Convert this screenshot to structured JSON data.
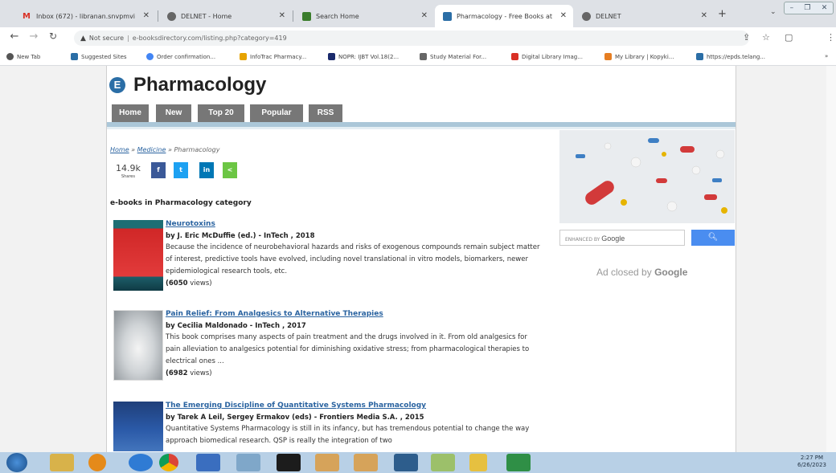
{
  "browser": {
    "tabs": [
      {
        "label": "Inbox (672) - libranan.snvpmvi",
        "icon_color": "#d93025"
      },
      {
        "label": "DELNET - Home",
        "icon_color": "#555555"
      },
      {
        "label": "Search Home",
        "icon_color": "#3a7d2c"
      },
      {
        "label": "Pharmacology - Free Books at",
        "icon_color": "#2b6ea6",
        "active": true
      },
      {
        "label": "DELNET",
        "icon_color": "#555555"
      }
    ],
    "new_tab": "+",
    "address": {
      "security": "Not secure",
      "url": "e-booksdirectory.com/listing.php?category=419"
    },
    "bookmarks": [
      {
        "label": "New Tab",
        "color": "#555555"
      },
      {
        "label": "Suggested Sites",
        "color": "#2b6ea6"
      },
      {
        "label": "Order confirmation...",
        "color": "#4285f4"
      },
      {
        "label": "InfoTrac Pharmacy...",
        "color": "#e6a300"
      },
      {
        "label": "NOPR: IJBT Vol.18(2...",
        "color": "#1a2a6c"
      },
      {
        "label": "Study Material For...",
        "color": "#666666"
      },
      {
        "label": "Digital Library Imag...",
        "color": "#d93025"
      },
      {
        "label": "My Library | Kopyki...",
        "color": "#e67e22"
      },
      {
        "label": "https://epds.telang...",
        "color": "#2b6ea6"
      }
    ],
    "bookmarks_more": "»"
  },
  "site": {
    "logo": "E",
    "title": "Pharmacology",
    "nav": [
      "Home",
      "New",
      "Top 20",
      "Popular",
      "RSS"
    ],
    "breadcrumb": {
      "home": "Home",
      "sep": " » ",
      "medicine": "Medicine",
      "current": "Pharmacology"
    },
    "share": {
      "count": "14.9k",
      "label": "Shares",
      "buttons": [
        "f",
        "t",
        "in",
        "<"
      ]
    },
    "category_heading": "e-books in Pharmacology category"
  },
  "books": [
    {
      "title": "Neurotoxins",
      "author": "by J. Eric McDuffie (ed.) - InTech , 2018",
      "description": "Because the incidence of neurobehavioral hazards and risks of exogenous compounds remain subject matter of interest, predictive tools have evolved, including novel translational in vitro models, biomarkers, newer epidemiological research tools, etc.",
      "views_count": "(6050",
      "views_label": "views)"
    },
    {
      "title": "Pain Relief: From Analgesics to Alternative Therapies",
      "author": "by Cecilia Maldonado - InTech , 2017",
      "description": "This book comprises many aspects of pain treatment and the drugs involved in it. From old analgesics for pain alleviation to analgesics potential for diminishing oxidative stress; from pharmacological therapies to electrical ones ...",
      "views_count": "(6982",
      "views_label": "views)"
    },
    {
      "title": "The Emerging Discipline of Quantitative Systems Pharmacology",
      "author": "by Tarek A Leil, Sergey Ermakov (eds) - Frontiers Media S.A. , 2015",
      "description": "Quantitative Systems Pharmacology is still in its infancy, but has tremendous potential to change the way we approach biomedical research. QSP is really the integration of two",
      "views_count": "",
      "views_label": ""
    }
  ],
  "sidebar": {
    "search_prefix": "ENHANCED BY",
    "search_brand": "Google",
    "ad_closed_prefix": "Ad closed by",
    "ad_closed_brand": "Google"
  },
  "taskbar": {
    "time": "2:27 PM",
    "date": "6/26/2023"
  }
}
